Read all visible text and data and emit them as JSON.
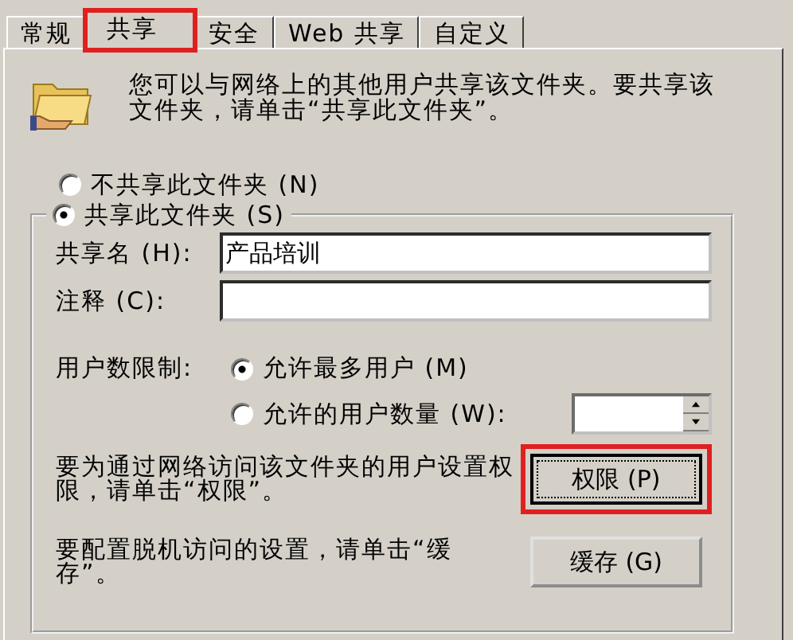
{
  "tabs": [
    {
      "label": "常规",
      "selected": false,
      "highlighted": false
    },
    {
      "label": "共享",
      "selected": true,
      "highlighted": true
    },
    {
      "label": "安全",
      "selected": false,
      "highlighted": false
    },
    {
      "label": "Web 共享",
      "selected": false,
      "highlighted": false
    },
    {
      "label": "自定义",
      "selected": false,
      "highlighted": false
    }
  ],
  "intro": "您可以与网络上的其他用户共享该文件夹。要共享该文件夹，请单击“共享此文件夹”。",
  "share_options": [
    {
      "label": "不共享此文件夹 (N)",
      "selected": false
    },
    {
      "label": "共享此文件夹 (S)",
      "selected": true
    }
  ],
  "share_name": {
    "label": "共享名 (H):",
    "value": "产品培训"
  },
  "comment": {
    "label": "注释 (C):"
  },
  "user_limit": {
    "label": "用户数限制:",
    "options": [
      {
        "label": "允许最多用户 (M)",
        "selected": true
      },
      {
        "label": "允许的用户数量 (W):",
        "selected": false
      }
    ]
  },
  "permissions": {
    "text": "要为通过网络访问该文件夹的用户设置权限，请单击“权限”。",
    "button": "权限 (P)",
    "highlighted": true,
    "focused": true
  },
  "caching": {
    "text": "要配置脱机访问的设置，请单击“缓存”。",
    "button": "缓存 (G)",
    "focused": false
  }
}
